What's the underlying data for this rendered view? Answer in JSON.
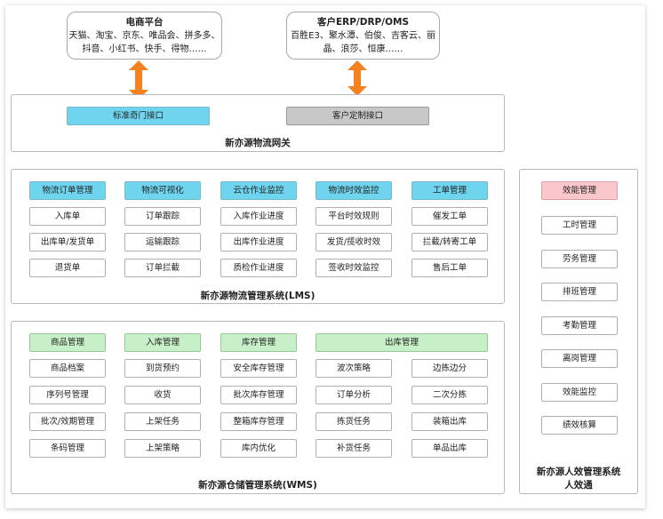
{
  "ecommerce": {
    "title": "电商平台",
    "line1": "天猫、淘宝、京东、唯品会、拼多多、",
    "line2": "抖音、小红书、快手、得物……"
  },
  "erp": {
    "title": "客户ERP/DRP/OMS",
    "line1": "百胜E3、聚水潭、伯俊、吉客云、丽",
    "line2": "晶、浪莎、恒康……"
  },
  "gateway": {
    "title": "新亦源物流网关",
    "qimen": "标准奇门接口",
    "custom": "客户定制接口"
  },
  "lms": {
    "title": "新亦源物流管理系统(LMS)",
    "columns": [
      {
        "header": "物流订单管理",
        "items": [
          "入库单",
          "出库单/发货单",
          "退货单"
        ]
      },
      {
        "header": "物流可视化",
        "items": [
          "订单跟踪",
          "运输跟踪",
          "订单拦截"
        ]
      },
      {
        "header": "云仓作业监控",
        "items": [
          "入库作业进度",
          "出库作业进度",
          "质检作业进度"
        ]
      },
      {
        "header": "物流时效监控",
        "items": [
          "平台时效规则",
          "发货/揽收时效",
          "签收时效监控"
        ]
      },
      {
        "header": "工单管理",
        "items": [
          "催发工单",
          "拦截/转寄工单",
          "售后工单"
        ]
      }
    ]
  },
  "wms": {
    "title": "新亦源仓储管理系统(WMS)",
    "columns": [
      {
        "header": "商品管理",
        "items": [
          "商品档案",
          "序列号管理",
          "批次/效期管理",
          "条码管理"
        ]
      },
      {
        "header": "入库管理",
        "items": [
          "到货预约",
          "收货",
          "上架任务",
          "上架策略"
        ]
      },
      {
        "header": "库存管理",
        "items": [
          "安全库存管理",
          "批次库存管理",
          "整箱库存管理",
          "库内优化"
        ]
      }
    ],
    "outbound": {
      "header": "出库管理",
      "left": [
        "波次策略",
        "订单分析",
        "拣货任务",
        "补货任务"
      ],
      "right": [
        "边拣边分",
        "二次分拣",
        "装箱出库",
        "单品出库"
      ]
    }
  },
  "hr": {
    "title_line1": "新亦源人效管理系统",
    "title_line2": "人效通",
    "header": "效能管理",
    "items": [
      "工时管理",
      "劳务管理",
      "排班管理",
      "考勤管理",
      "离岗管理",
      "效能监控",
      "绩效核算"
    ]
  },
  "colors": {
    "arrow": "#f58220",
    "lms_header": "#6fd5ee",
    "wms_header": "#c8f0c8",
    "hr_header": "#f9c7cc",
    "custom_interface": "#c8c8c8"
  }
}
